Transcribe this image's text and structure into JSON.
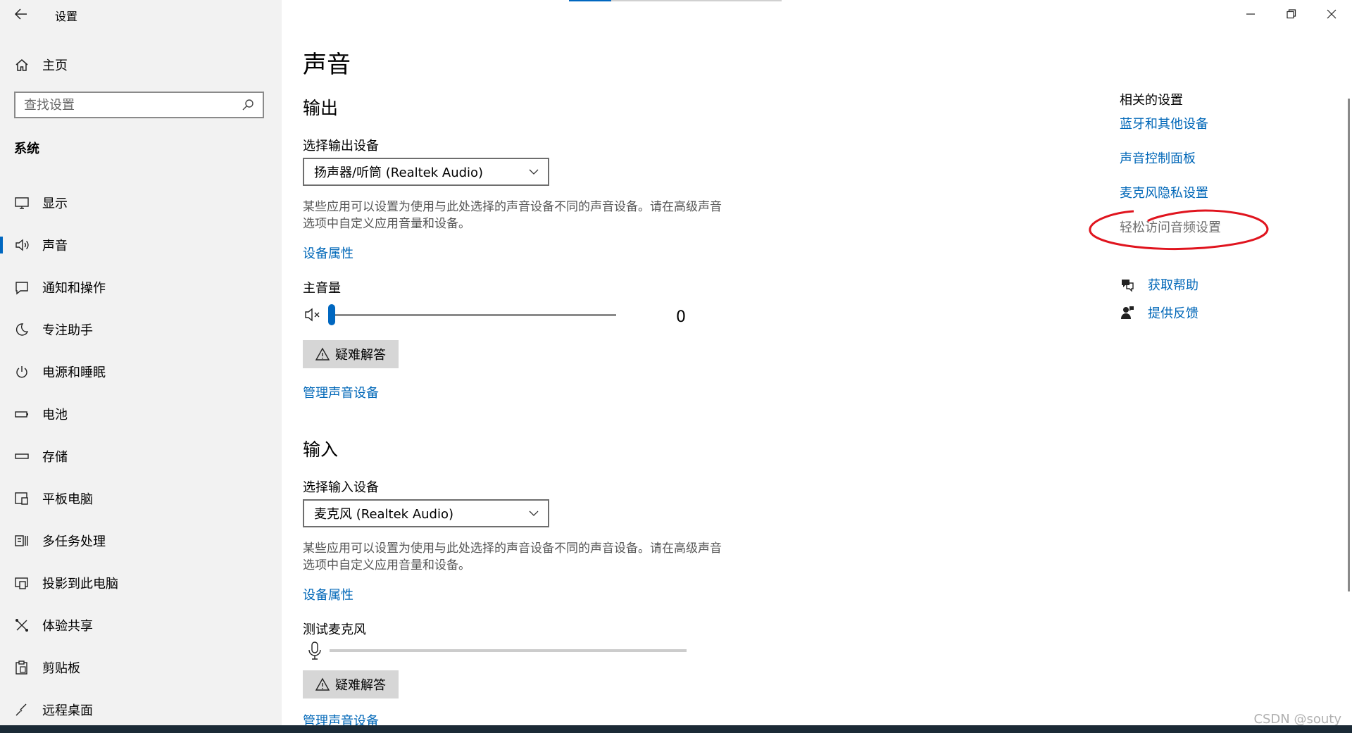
{
  "app": {
    "title": "设置"
  },
  "sidebar": {
    "home_label": "主页",
    "search_placeholder": "查找设置",
    "section": "系统",
    "items": [
      {
        "label": "显示",
        "icon": "monitor-icon"
      },
      {
        "label": "声音",
        "icon": "speaker-icon",
        "active": true
      },
      {
        "label": "通知和操作",
        "icon": "notification-icon"
      },
      {
        "label": "专注助手",
        "icon": "moon-icon"
      },
      {
        "label": "电源和睡眠",
        "icon": "power-icon"
      },
      {
        "label": "电池",
        "icon": "battery-icon"
      },
      {
        "label": "存储",
        "icon": "storage-icon"
      },
      {
        "label": "平板电脑",
        "icon": "tablet-icon"
      },
      {
        "label": "多任务处理",
        "icon": "multitask-icon"
      },
      {
        "label": "投影到此电脑",
        "icon": "project-icon"
      },
      {
        "label": "体验共享",
        "icon": "share-icon"
      },
      {
        "label": "剪贴板",
        "icon": "clipboard-icon"
      },
      {
        "label": "远程桌面",
        "icon": "remote-desktop-icon"
      }
    ]
  },
  "main": {
    "title": "声音",
    "output": {
      "heading": "输出",
      "device_label": "选择输出设备",
      "device_value": "扬声器/听筒 (Realtek Audio)",
      "description": "某些应用可以设置为使用与此处选择的声音设备不同的声音设备。请在高级声音选项中自定义应用音量和设备。",
      "properties_link": "设备属性",
      "volume_label": "主音量",
      "volume_value": "0",
      "volume_level": 0,
      "troubleshoot_label": "疑难解答",
      "manage_link": "管理声音设备"
    },
    "input": {
      "heading": "输入",
      "device_label": "选择输入设备",
      "device_value": "麦克风 (Realtek Audio)",
      "description": "某些应用可以设置为使用与此处选择的声音设备不同的声音设备。请在高级声音选项中自定义应用音量和设备。",
      "properties_link": "设备属性",
      "test_label": "测试麦克风",
      "mic_level": 0,
      "troubleshoot_label": "疑难解答",
      "manage_link": "管理声音设备"
    }
  },
  "related": {
    "title": "相关的设置",
    "links": [
      "蓝牙和其他设备",
      "声音控制面板",
      "麦克风隐私设置",
      "轻松访问音频设置"
    ],
    "help": "获取帮助",
    "feedback": "提供反馈"
  },
  "watermark": "CSDN @souty",
  "colors": {
    "accent": "#0067c0",
    "link": "#0067b8",
    "annotation": "#e0141e"
  }
}
